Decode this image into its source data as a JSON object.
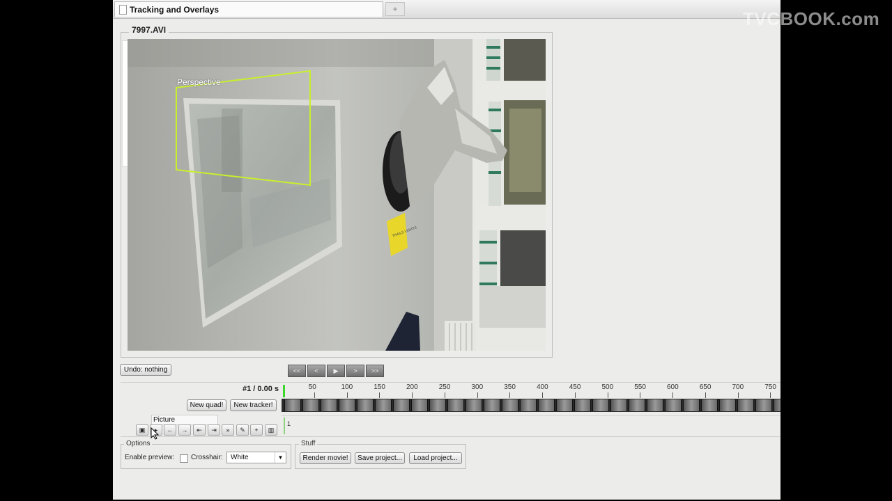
{
  "window": {
    "tab_title": "Tracking and Overlays",
    "new_tab_icon": "plus-icon",
    "watermark": "TVCBOOK.com"
  },
  "video": {
    "filename": "7997.AVI",
    "overlay_label": "Perspective",
    "overlay_color": "#c8f02a",
    "sticky_note_text": "TRAILS LIGHTS"
  },
  "toolbar": {
    "undo_label": "Undo: nothing",
    "nav": [
      {
        "name": "first-frame-button",
        "glyph": "<<"
      },
      {
        "name": "prev-frame-button",
        "glyph": "<"
      },
      {
        "name": "play-button",
        "glyph": "▶"
      },
      {
        "name": "next-frame-button",
        "glyph": ">"
      },
      {
        "name": "last-frame-button",
        "glyph": ">>"
      }
    ]
  },
  "timeline": {
    "frame_label": "#1 / 0.00 s",
    "ticks": [
      "50",
      "100",
      "150",
      "200",
      "250",
      "300",
      "350",
      "400",
      "450",
      "500",
      "550",
      "600",
      "650",
      "700",
      "750"
    ],
    "playhead_color": "#3dd62b",
    "new_quad_label": "New quad!",
    "new_tracker_label": "New tracker!",
    "track_name": "Picture",
    "track_start": "1"
  },
  "options": {
    "legend": "Options",
    "enable_preview_label": "Enable preview:",
    "enable_preview_checked": false,
    "crosshair_label": "Crosshair:",
    "crosshair_value": "White"
  },
  "stuff": {
    "legend": "Stuff",
    "render_label": "Render movie!",
    "save_label": "Save project...",
    "load_label": "Load project..."
  }
}
